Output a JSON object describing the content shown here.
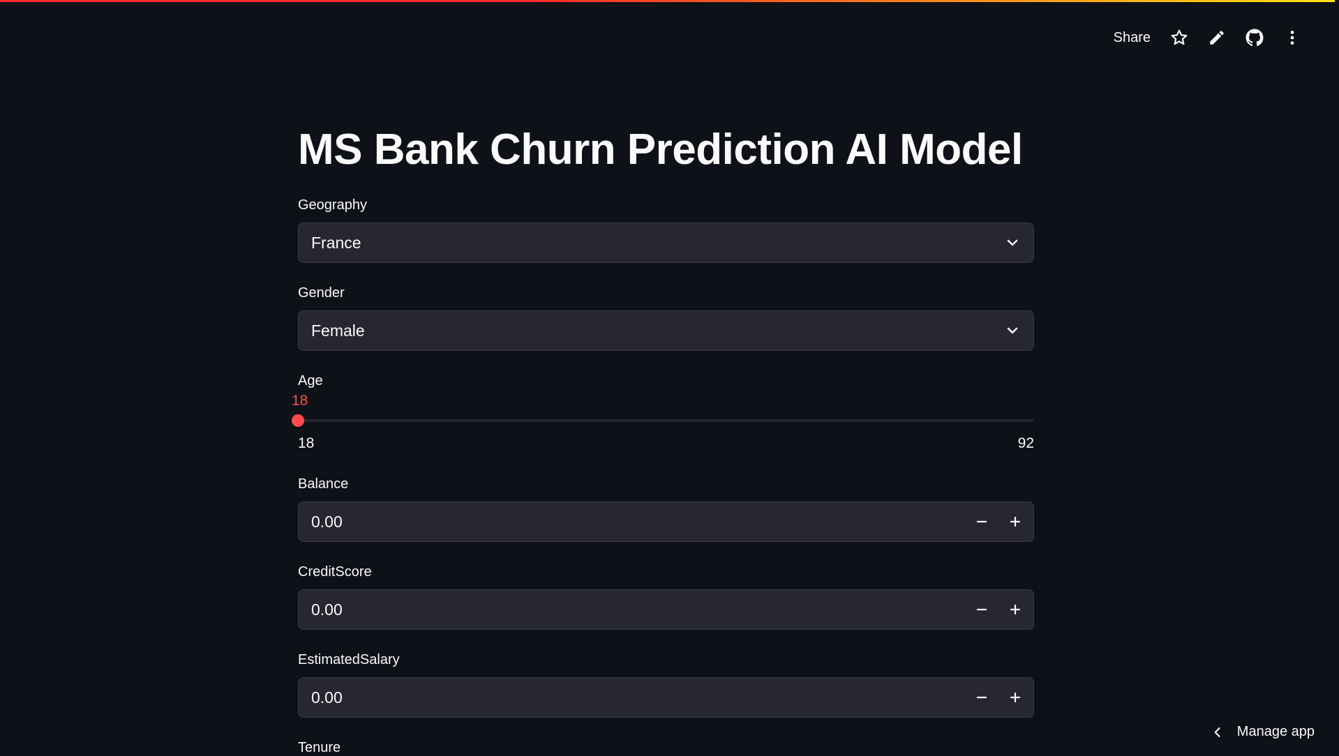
{
  "header": {
    "share_label": "Share",
    "icons": [
      "star-icon",
      "pencil-icon",
      "github-icon",
      "more-vertical-icon"
    ]
  },
  "page": {
    "title": "MS Bank Churn Prediction AI Model"
  },
  "fields": {
    "geography": {
      "label": "Geography",
      "value": "France"
    },
    "gender": {
      "label": "Gender",
      "value": "Female"
    },
    "age": {
      "label": "Age",
      "value": "18",
      "min": "18",
      "max": "92",
      "fraction": 0
    },
    "balance": {
      "label": "Balance",
      "value": "0.00"
    },
    "credit_score": {
      "label": "CreditScore",
      "value": "0.00"
    },
    "estimated_salary": {
      "label": "EstimatedSalary",
      "value": "0.00"
    },
    "tenure": {
      "label": "Tenure"
    }
  },
  "footer": {
    "manage_label": "Manage app"
  },
  "colors": {
    "background": "#0e1117",
    "accent": "#ff4b4b",
    "input_bg": "#262730"
  }
}
